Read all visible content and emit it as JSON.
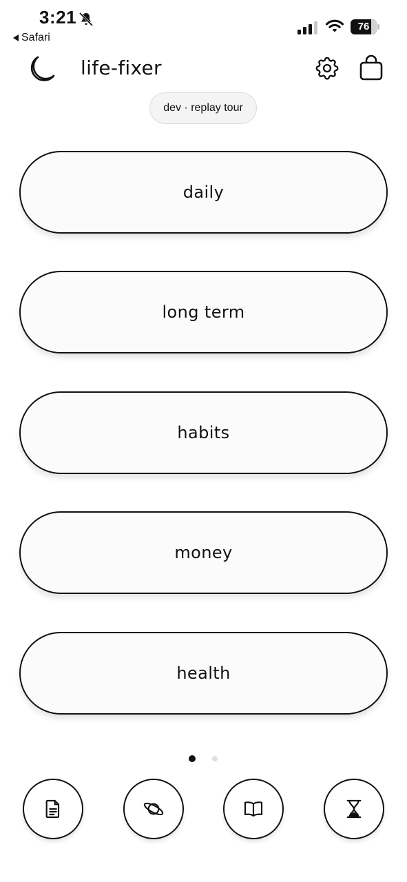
{
  "status_bar": {
    "time": "3:21",
    "back_app": "Safari",
    "battery": "76",
    "icons": [
      "bell-slash-icon",
      "signal-icon",
      "wifi-icon",
      "battery-icon"
    ]
  },
  "header": {
    "title": "life-fixer",
    "icons": [
      "moon-icon",
      "gear-icon",
      "bag-icon"
    ]
  },
  "dev_button": "dev · replay tour",
  "categories": [
    {
      "label": "daily"
    },
    {
      "label": "long term"
    },
    {
      "label": "habits"
    },
    {
      "label": "money"
    },
    {
      "label": "health"
    }
  ],
  "pager": {
    "current": 1,
    "total": 2
  },
  "bottom_nav": [
    "document-icon",
    "planet-icon",
    "book-icon",
    "hourglass-icon"
  ]
}
